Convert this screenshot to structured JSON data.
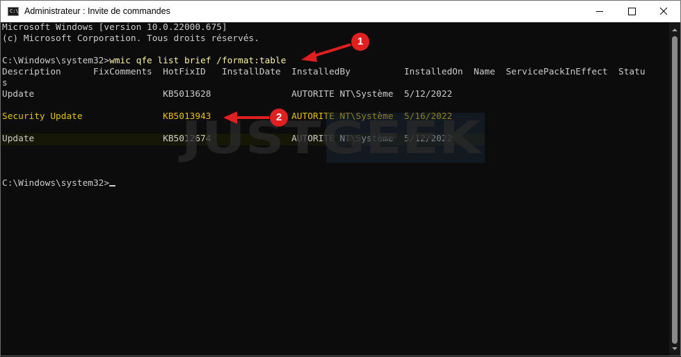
{
  "window": {
    "title": "Administrateur : Invite de commandes",
    "icon_text": "C:\\",
    "icon_name": "cmd-icon"
  },
  "console": {
    "lines": [
      "Microsoft Windows [version 10.0.22000.675]",
      "(c) Microsoft Corporation. Tous droits réservés.",
      "",
      "C:\\Windows\\system32>",
      "Description      FixComments  HotFixID   InstallDate  InstalledBy          InstalledOn  Name  ServicePackInEffect  Statu",
      "s",
      "Update                        KB5013628               AUTORITE NT\\Système  5/12/2022",
      "",
      "Security Update               KB5013943               AUTORITE NT\\Système  5/16/2022",
      "",
      "Update                        KB5012674               AUTORITE NT\\Système  5/12/2022",
      "",
      "",
      "",
      "C:\\Windows\\system32>"
    ],
    "command": "wmic qfe list brief /format:table"
  },
  "watermark": "JUSTGEEK",
  "annotations": {
    "badge_1": "1",
    "badge_2": "2"
  },
  "colors": {
    "background": "#0c0c0c",
    "text": "#cccccc",
    "command": "#f9f1a5",
    "highlight_row": "#e5c100",
    "annotation": "#e02020"
  }
}
